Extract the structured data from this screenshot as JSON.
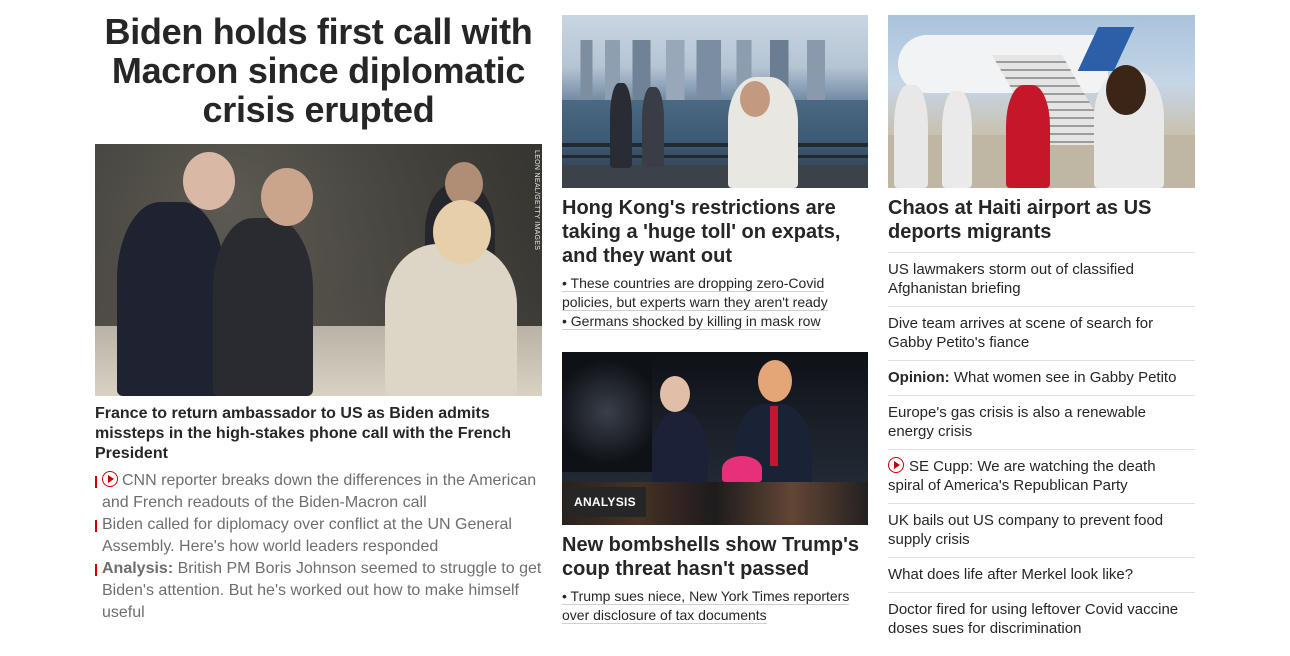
{
  "hero": {
    "headline": "Biden holds first call with Macron since diplomatic crisis erupted",
    "photo_credit": "LEON NEAL/GETTY IMAGES",
    "subheadline": "France to return ambassador to US as Biden admits missteps in the high-stakes phone call with the French President",
    "related": [
      {
        "prefix": "",
        "text": "CNN reporter breaks down the differences in the American and French readouts of the Biden-Macron call",
        "video": true
      },
      {
        "prefix": "",
        "text": "Biden called for diplomacy over conflict at the UN General Assembly. Here's how world leaders responded",
        "video": false
      },
      {
        "prefix": "Analysis:",
        "text": " British PM Boris Johnson seemed to struggle to get Biden's attention. But he's worked out how to make himself useful",
        "video": false
      }
    ]
  },
  "story_hk": {
    "title": "Hong Kong's restrictions are taking a 'huge toll' on expats, and they want out",
    "bullets": [
      "• These countries are dropping zero-Covid policies, but experts warn they aren't ready",
      "• Germans shocked by killing in mask row"
    ]
  },
  "story_trump": {
    "tag": "ANALYSIS",
    "title": "New bombshells show Trump's coup threat hasn't passed",
    "bullets": [
      "• Trump sues niece, New York Times reporters over disclosure of tax documents"
    ]
  },
  "story_haiti": {
    "title": "Chaos at Haiti airport as US deports migrants",
    "links": [
      {
        "prefix": "",
        "text": "US lawmakers storm out of classified Afghanistan briefing",
        "video": false
      },
      {
        "prefix": "",
        "text": "Dive team arrives at scene of search for Gabby Petito's fiance",
        "video": false
      },
      {
        "prefix": "Opinion:",
        "text": " What women see in Gabby Petito",
        "video": false
      },
      {
        "prefix": "",
        "text": "Europe's gas crisis is also a renewable energy crisis",
        "video": false
      },
      {
        "prefix": "",
        "text": "SE Cupp: We are watching the death spiral of America's Republican Party",
        "video": true
      },
      {
        "prefix": "",
        "text": "UK bails out US company to prevent food supply crisis",
        "video": false
      },
      {
        "prefix": "",
        "text": "What does life after Merkel look like?",
        "video": false
      },
      {
        "prefix": "",
        "text": "Doctor fired for using leftover Covid vaccine doses sues for discrimination",
        "video": false
      }
    ]
  },
  "colors": {
    "accent_red": "#cc0000",
    "text_dark": "#262626",
    "text_muted": "#6e6e6e",
    "divider": "#e1e1e1"
  }
}
